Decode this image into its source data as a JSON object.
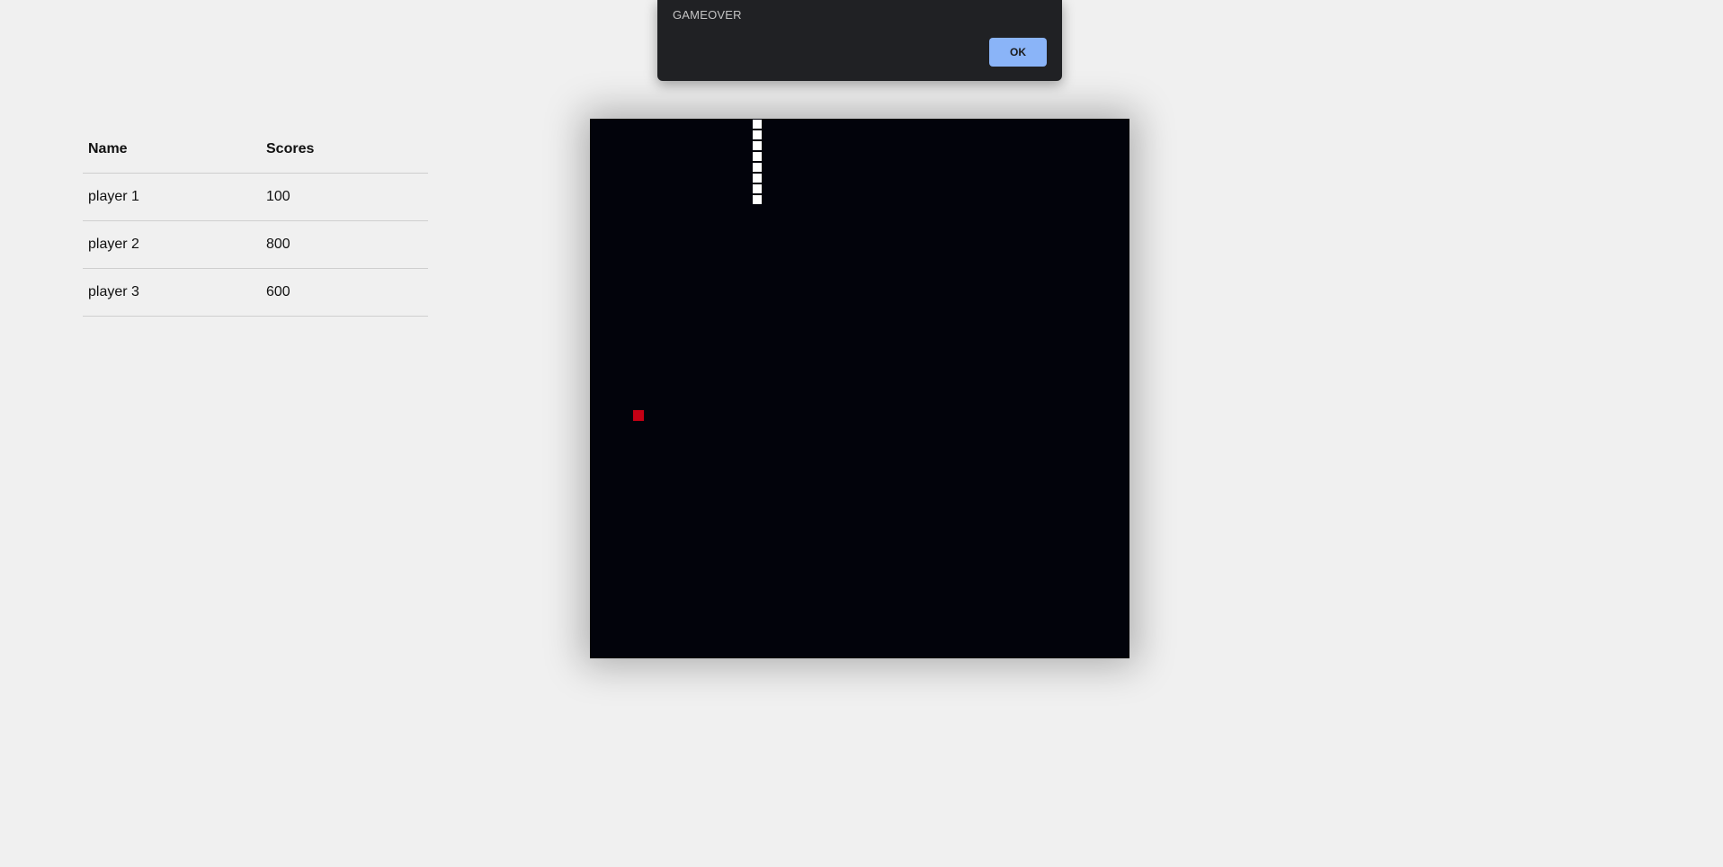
{
  "scoreboard": {
    "headers": [
      "Name",
      "Scores"
    ],
    "rows": [
      {
        "name": "player 1",
        "score": "100"
      },
      {
        "name": "player 2",
        "score": "800"
      },
      {
        "name": "player 3",
        "score": "600"
      }
    ]
  },
  "dialog": {
    "message": "GAMEOVER",
    "ok_label": "OK"
  },
  "game": {
    "grid_cells": 50,
    "snake_color": "#ffffff",
    "food_color": "#c40014",
    "board_color": "#02030b",
    "snake_segments": [
      {
        "col": 15,
        "row": 0
      },
      {
        "col": 15,
        "row": 1
      },
      {
        "col": 15,
        "row": 2
      },
      {
        "col": 15,
        "row": 3
      },
      {
        "col": 15,
        "row": 4
      },
      {
        "col": 15,
        "row": 5
      },
      {
        "col": 15,
        "row": 6
      },
      {
        "col": 15,
        "row": 7
      }
    ],
    "food": {
      "col": 4,
      "row": 27
    }
  },
  "colors": {
    "dialog_background": "#202124",
    "ok_button": "#8ab4f8",
    "page_background": "#f0f0f0"
  }
}
